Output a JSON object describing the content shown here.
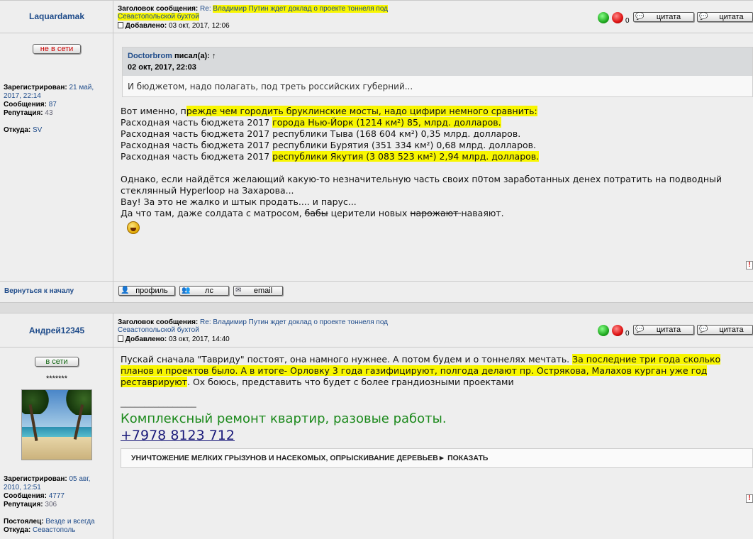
{
  "post1": {
    "username": "Laquardamak",
    "status": "не в сети",
    "status_color": "#cc0000",
    "subject_label": "Заголовок сообщения:",
    "subject_prefix": "Re:",
    "subject_line1": "Владимир Путин ждет доклад о проекте тоннеля под",
    "subject_line2": "Севастопольской бухтой",
    "added_label": "Добавлено:",
    "added_date": "03 окт, 2017, 12:06",
    "vote_count": "0",
    "quote_btn_1": "цитата",
    "quote_btn_2": "цитата",
    "reg_label": "Зарегистрирован:",
    "reg_value_1": "21 май,",
    "reg_value_2": "2017, 22:14",
    "messages_label": "Сообщения:",
    "messages_value": "87",
    "rep_label": "Репутация:",
    "rep_value": "43",
    "from_label": "Откуда:",
    "from_value": "SV",
    "quote_author": "Doctorbrom",
    "quote_wrote": "писал(а):",
    "quote_arrow": "↑",
    "quote_date": "02 окт, 2017, 22:03",
    "quote_text": "И бюджетом, надо полагать, под треть российских губерний...",
    "body_l1_a": "Вот именно, п",
    "body_l1_b": "режде чем городить бруклинские мосты, надо цифири немного сравнить:",
    "body_l2_a": "Расходная часть бюджета 2017 ",
    "body_l2_b": "города Нью-Йорк (1214 км²) 85, млрд. долларов.",
    "body_l3": "Расходная часть бюджета 2017 республики Тыва (168 604 км²) 0,35 млрд. долларов.",
    "body_l4": "Расходная часть бюджета 2017 республики Бурятия (351 334 км²) 0,68 млрд. долларов.",
    "body_l5_a": "Расходная часть бюджета 2017 ",
    "body_l5_b": "республики Якутия (3 083 523 км²) 2,94 млрд. долларов.",
    "body_l6": "Однако, если найдётся желающий какую-то незначительную часть своих п0том заработанных денех потратить на подводный",
    "body_l7": "стеклянный Hyperloop на Захарова...",
    "body_l8": "Вау! За это не жалко и штык продать.... и парус...",
    "body_l9_a": "Да что там, даже солдата с матросом, ",
    "body_l9_strike1": "бабы",
    "body_l9_b": " церители новых ",
    "body_l9_strike2": "нарожают ",
    "body_l9_c": "наваяют.",
    "back_to_top": "Вернуться к началу",
    "profile_btn": "профиль",
    "pm_btn": "лс",
    "email_btn": "email"
  },
  "post2": {
    "username": "Андрей12345",
    "status": "в сети",
    "status_color": "#116611",
    "stars": "*******",
    "subject_label": "Заголовок сообщения:",
    "subject_prefix": "Re:",
    "subject_line1": "Владимир Путин ждет доклад о проекте тоннеля под",
    "subject_line2": "Севастопольской бухтой",
    "added_label": "Добавлено:",
    "added_date": "03 окт, 2017, 14:40",
    "vote_count": "0",
    "quote_btn_1": "цитата",
    "quote_btn_2": "цитата",
    "reg_label": "Зарегистрирован:",
    "reg_value_1": "05 авг,",
    "reg_value_2": "2010, 12:51",
    "messages_label": "Сообщения:",
    "messages_value": "4777",
    "rep_label": "Репутация:",
    "rep_value": "306",
    "resident_label": "Постоялец:",
    "resident_value": "Везде и всегда",
    "from_label": "Откуда:",
    "from_value": "Севастополь",
    "body_l1_a": "Пускай сначала \"Тавриду\" постоят, она намного нужнее. А потом будем и о тоннелях мечтать. ",
    "body_l1_b": "За последние три года сколько",
    "body_l2": "планов и проектов было. А в итоге- Орловку 3 года газифицируют, полгода делают пр. Острякова, Малахов курган уже год",
    "body_l3_a": "реставрируют",
    "body_l3_b": ". Ох боюсь, представить что будет с более грандиозными проектами",
    "sig_line": "________________",
    "sig_ad": "Комплексный ремонт квартир, разовые работы.",
    "sig_phone": "+7978 8123 712",
    "ad_banner": "УНИЧТОЖЕНИЕ МЕЛКИХ ГРЫЗУНОВ И НАСЕКОМЫХ, ОПРЫСКИВАНИЕ ДЕРЕВЬЕВ",
    "ad_show": "► ПОКАЗАТЬ"
  },
  "colors": {
    "highlight": "#f8f600",
    "link": "#1e4b8a",
    "signature_green": "#1d8a1d",
    "phone_blue": "#1a1a7a"
  },
  "icons": {
    "vote_up": "thumb-up-green-icon",
    "vote_down": "thumb-down-red-icon",
    "post": "post-icon",
    "smiley": "laughing-smiley-icon",
    "report": "report-icon"
  }
}
